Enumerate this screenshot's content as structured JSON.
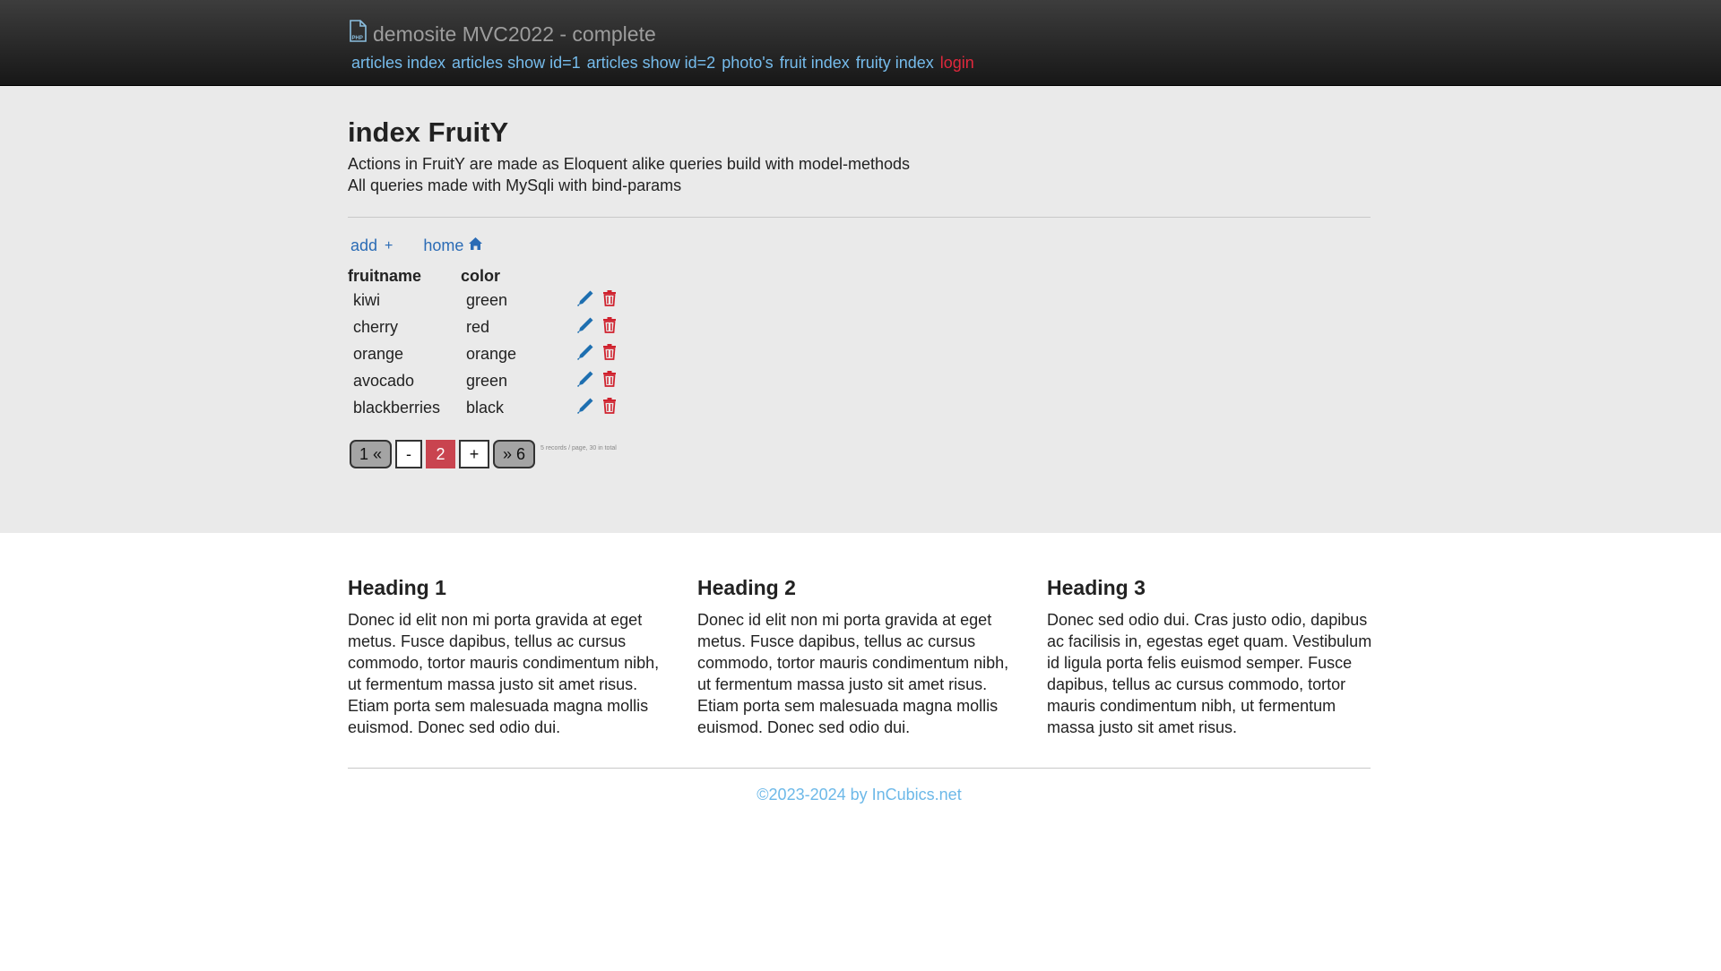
{
  "navbar": {
    "brand_icon": "php-file-icon",
    "brand": "demosite MVC2022 - complete",
    "links": [
      "articles index",
      "articles show id=1",
      "articles show id=2",
      "photo's",
      "fruit index",
      "fruity index",
      "login"
    ]
  },
  "main": {
    "title": "index FruitY",
    "lines": [
      "Actions in FruitY are made as Eloquent alike queries build with model-methods",
      "All queries made with MySqli with bind-params"
    ],
    "add_label": "add",
    "add_icon": "plus-icon",
    "home_label": "home",
    "home_icon": "home-icon"
  },
  "table": {
    "headers": [
      "fruitname",
      "color"
    ],
    "rows": [
      {
        "fruitname": "kiwi",
        "color": "green"
      },
      {
        "fruitname": "cherry",
        "color": "red"
      },
      {
        "fruitname": "orange",
        "color": "orange"
      },
      {
        "fruitname": "avocado",
        "color": "green"
      },
      {
        "fruitname": "blackberries",
        "color": "black"
      }
    ],
    "row_icons": [
      "pencil-icon",
      "trash-icon"
    ]
  },
  "pager": {
    "first": "1 «",
    "prev": "-",
    "current": "2",
    "next": "+",
    "last": "» 6",
    "note": "5 records / page, 30 in total"
  },
  "columns": [
    {
      "heading": "Heading 1",
      "text": "Donec id elit non mi porta gravida at eget metus. Fusce dapibus, tellus ac cursus commodo, tortor mauris condimentum nibh, ut fermentum massa justo sit amet risus. Etiam porta sem malesuada magna mollis euismod. Donec sed odio dui."
    },
    {
      "heading": "Heading 2",
      "text": "Donec id elit non mi porta gravida at eget metus. Fusce dapibus, tellus ac cursus commodo, tortor mauris condimentum nibh, ut fermentum massa justo sit amet risus. Etiam porta sem malesuada magna mollis euismod. Donec sed odio dui."
    },
    {
      "heading": "Heading 3",
      "text": "Donec sed odio dui. Cras justo odio, dapibus ac facilisis in, egestas eget quam. Vestibulum id ligula porta felis euismod semper. Fusce dapibus, tellus ac cursus commodo, tortor mauris condimentum nibh, ut fermentum massa justo sit amet risus."
    }
  ],
  "footer": {
    "text": "©2023-2024 by InCubics.net"
  },
  "colors": {
    "nav_link": "#76bcec",
    "login_link": "#e0283c",
    "action_link": "#2a6bb5",
    "edit_icon": "#1e6fb0",
    "delete_icon": "#d0222e",
    "pager_active": "#c9444f",
    "footer_text": "#6cb8e8",
    "jumbotron_bg": "#eaeaea"
  }
}
